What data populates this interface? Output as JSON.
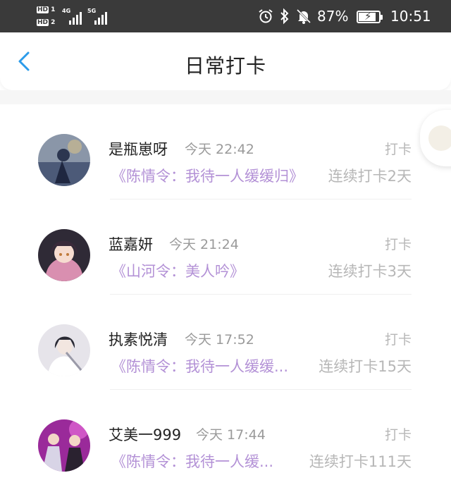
{
  "status_bar": {
    "sim1_label": "HD",
    "sim1_slot": "1",
    "sim2_label": "HD",
    "sim2_slot": "2",
    "network1": "4G",
    "network2": "5G",
    "battery_percent": "87%",
    "battery_level": 0.87,
    "time": "10:51",
    "icons": [
      "alarm-icon",
      "bluetooth-icon",
      "mute-icon",
      "battery-icon"
    ]
  },
  "nav": {
    "back_icon": "chevron-left-icon",
    "title": "日常打卡"
  },
  "colors": {
    "accent": "#2b9bea",
    "book_title": "#b391d6",
    "muted": "#b7b7b7"
  },
  "checkins": [
    {
      "name": "是瓶崽呀",
      "time": "今天 22:42",
      "action": "打卡",
      "book": "《陈情令：我待一人缓缓归》",
      "streak": "连续打卡2天"
    },
    {
      "name": "蓝嘉妍",
      "time": "今天 21:24",
      "action": "打卡",
      "book": "《山河令：美人吟》",
      "streak": "连续打卡3天"
    },
    {
      "name": "执素悦清",
      "time": "今天 17:52",
      "action": "打卡",
      "book": "《陈情令：我待一人缓缓...",
      "streak": "连续打卡15天"
    },
    {
      "name": "艾美一999",
      "time": "今天 17:44",
      "action": "打卡",
      "book": "《陈情令：我待一人缓...",
      "streak": "连续打卡111天"
    }
  ]
}
